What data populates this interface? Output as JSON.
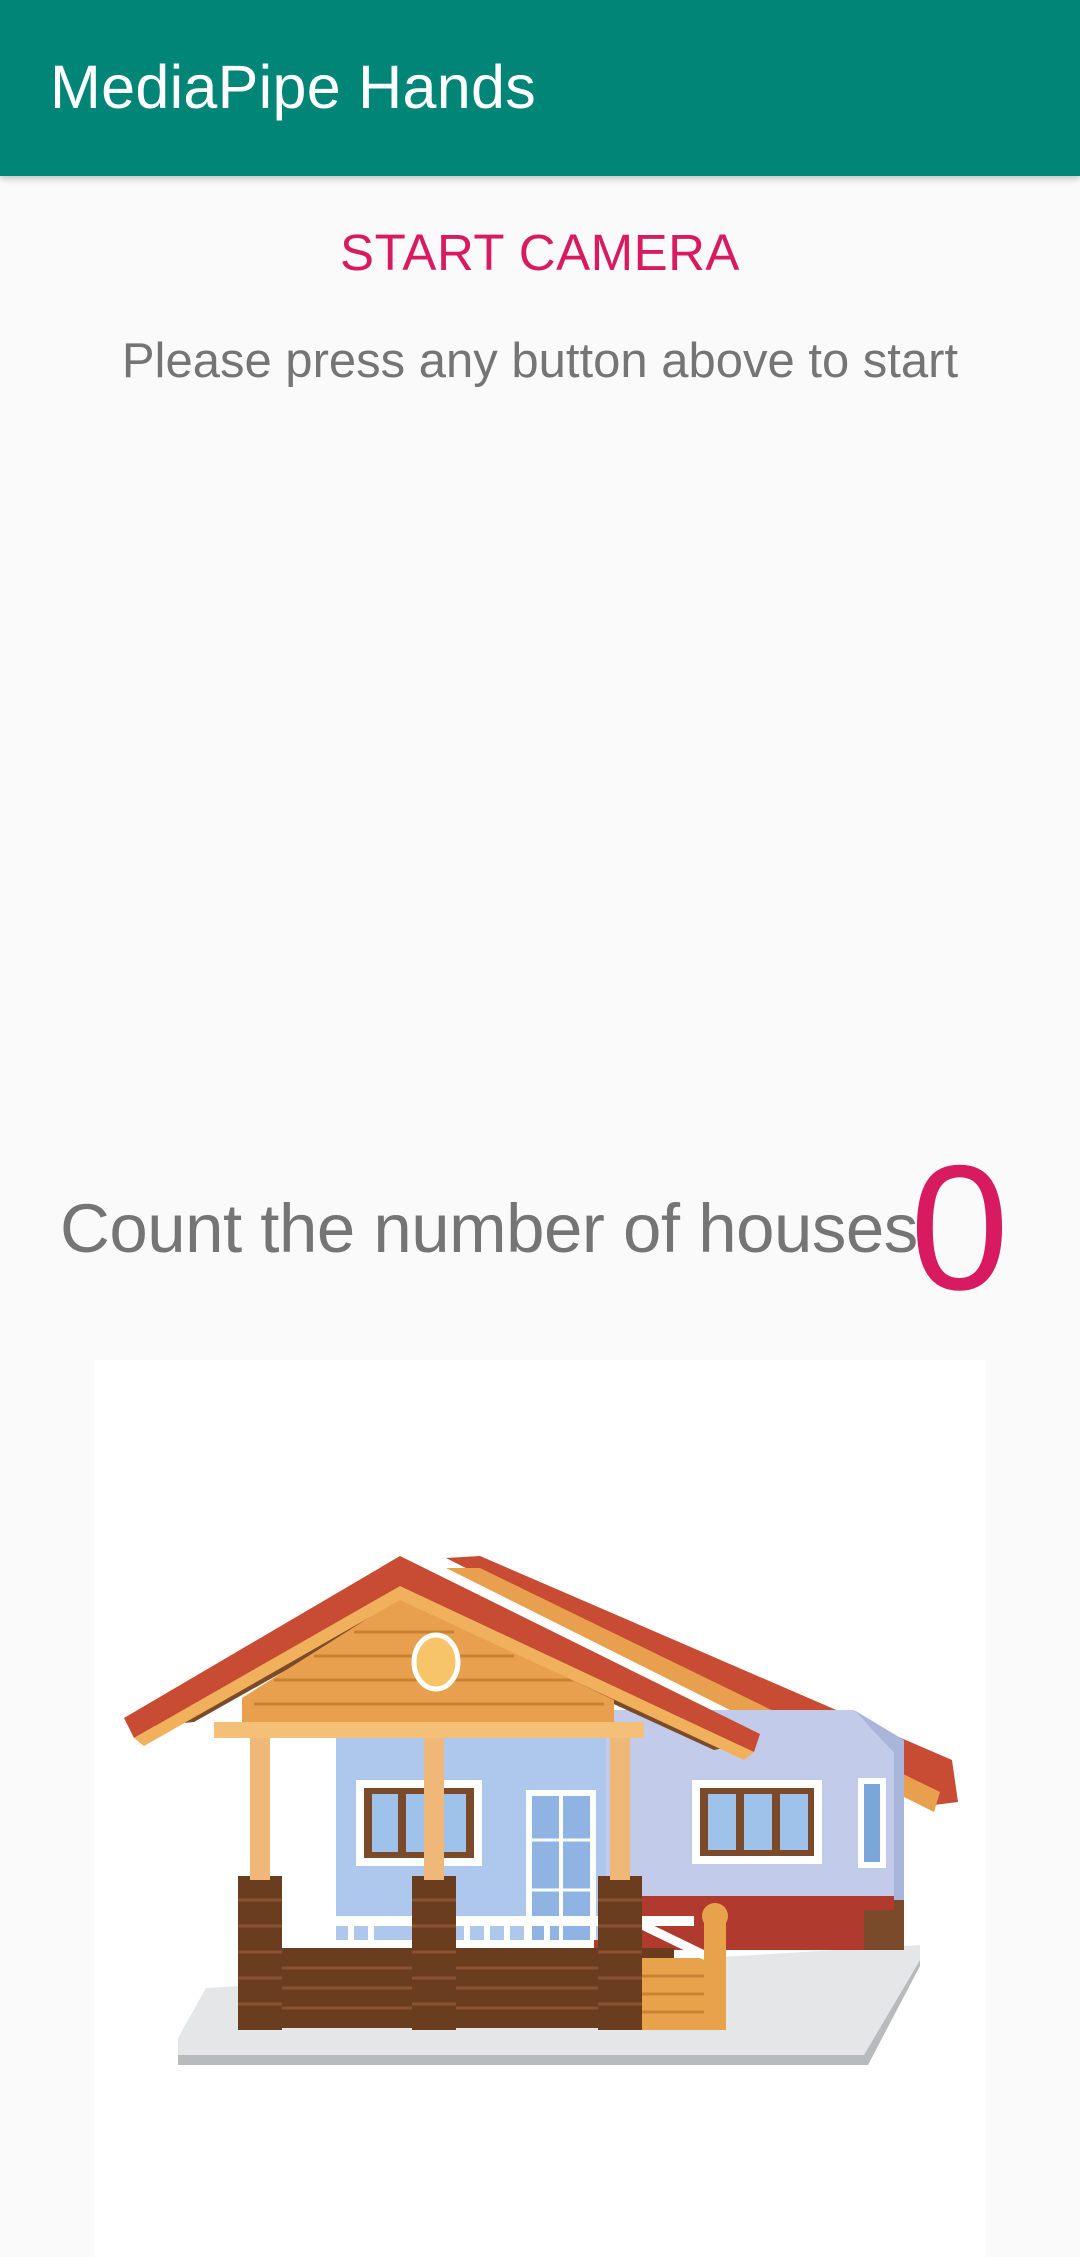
{
  "app_bar": {
    "title": "MediaPipe Hands",
    "color": "#008577"
  },
  "controls": {
    "start_camera_label": "START CAMERA",
    "accent_color": "#d81b60"
  },
  "status": {
    "hint": "Please press any button above to start"
  },
  "task": {
    "question": "Count the number of houses",
    "count": "0"
  },
  "image": {
    "subject": "house-illustration"
  }
}
